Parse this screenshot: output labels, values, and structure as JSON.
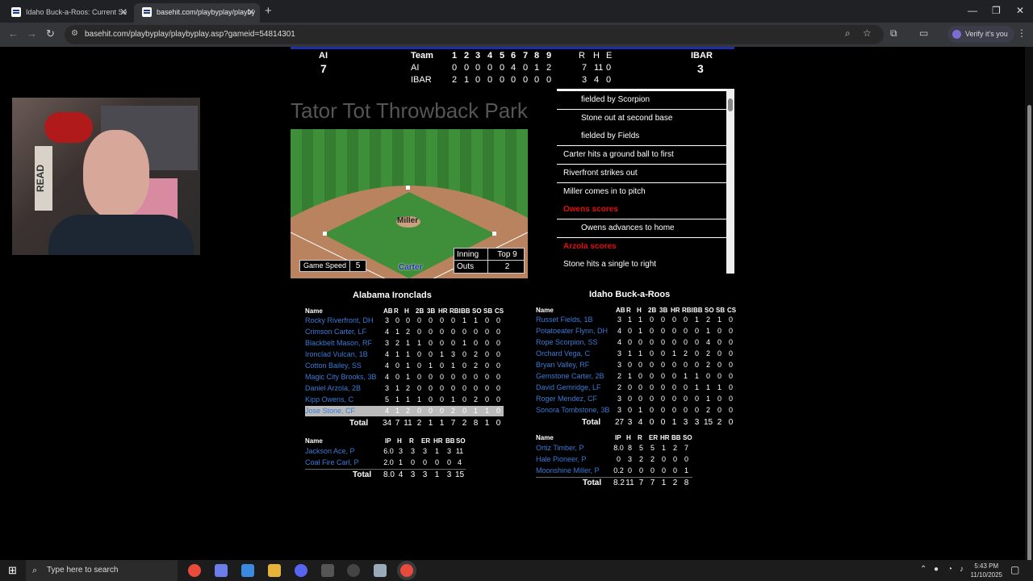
{
  "browser": {
    "tabs": [
      {
        "title": "Idaho Buck-a-Roos: Current Se",
        "active": false
      },
      {
        "title": "basehit.com/playbyplay/playby",
        "active": true
      }
    ],
    "url": "basehit.com/playbyplay/playbyplay.asp?gameid=54814301",
    "profile_label": "Verify it's you"
  },
  "scoreboard": {
    "away_abbr": "AI",
    "away_runs": "7",
    "home_abbr": "IBAR",
    "home_runs": "3",
    "header_team": "Team",
    "innings": [
      "1",
      "2",
      "3",
      "4",
      "5",
      "6",
      "7",
      "8",
      "9"
    ],
    "rhe_headers": [
      "R",
      "H",
      "E"
    ],
    "rows": [
      {
        "team": "AI",
        "line": [
          "0",
          "0",
          "0",
          "0",
          "0",
          "4",
          "0",
          "1",
          "2"
        ],
        "rhe": [
          "7",
          "11",
          "0"
        ]
      },
      {
        "team": "IBAR",
        "line": [
          "2",
          "1",
          "0",
          "0",
          "0",
          "0",
          "0",
          "0",
          "0"
        ],
        "rhe": [
          "3",
          "4",
          "0"
        ]
      }
    ]
  },
  "park_name": "Tator Tot Throwback Park",
  "field": {
    "pitcher": "Miller",
    "batter": "Carter",
    "game_speed_label": "Game Speed",
    "game_speed": "5",
    "inning_label": "Inning",
    "inning": "Top 9",
    "outs_label": "Outs",
    "outs": "2"
  },
  "play_by_play": [
    {
      "text": "fielded by Scorpion",
      "indent": true,
      "highlight": false
    },
    {
      "text": "Stone out at second base",
      "indent": true,
      "highlight": false
    },
    {
      "text": "fielded by Fields",
      "indent": true,
      "highlight": false
    },
    {
      "text": "Carter hits a ground ball to first",
      "indent": false,
      "highlight": false
    },
    {
      "text": "Riverfront strikes out",
      "indent": false,
      "highlight": false
    },
    {
      "text": "Miller comes in to pitch",
      "indent": false,
      "highlight": false
    },
    {
      "text": "Owens scores",
      "indent": false,
      "highlight": true
    },
    {
      "text": "Owens advances to home",
      "indent": true,
      "highlight": false
    },
    {
      "text": "Arzola scores",
      "indent": false,
      "highlight": true
    },
    {
      "text": "Stone hits a single to right",
      "indent": false,
      "highlight": false
    }
  ],
  "box_away": {
    "team": "Alabama Ironclads",
    "bat_headers": [
      "Name",
      "AB",
      "R",
      "H",
      "2B",
      "3B",
      "HR",
      "RBI",
      "BB",
      "SO",
      "SB",
      "CS"
    ],
    "batters": [
      {
        "name": "Rocky Riverfront, DH",
        "stats": [
          "3",
          "0",
          "0",
          "0",
          "0",
          "0",
          "0",
          "1",
          "1",
          "0",
          "0"
        ]
      },
      {
        "name": "Crimson Carter, LF",
        "stats": [
          "4",
          "1",
          "2",
          "0",
          "0",
          "0",
          "0",
          "0",
          "0",
          "0",
          "0"
        ]
      },
      {
        "name": "Blackbelt Mason, RF",
        "stats": [
          "3",
          "2",
          "1",
          "1",
          "0",
          "0",
          "0",
          "1",
          "0",
          "0",
          "0"
        ]
      },
      {
        "name": "Ironclad Vulcan, 1B",
        "stats": [
          "4",
          "1",
          "1",
          "0",
          "0",
          "1",
          "3",
          "0",
          "2",
          "0",
          "0"
        ]
      },
      {
        "name": "Cotton Bailey, SS",
        "stats": [
          "4",
          "0",
          "1",
          "0",
          "1",
          "0",
          "1",
          "0",
          "2",
          "0",
          "0"
        ]
      },
      {
        "name": "Magic City Brooks, 3B",
        "stats": [
          "4",
          "0",
          "1",
          "0",
          "0",
          "0",
          "0",
          "0",
          "0",
          "0",
          "0"
        ]
      },
      {
        "name": "Daniel Arzola, 2B",
        "stats": [
          "3",
          "1",
          "2",
          "0",
          "0",
          "0",
          "0",
          "0",
          "0",
          "0",
          "0"
        ]
      },
      {
        "name": "Kipp Owens, C",
        "stats": [
          "5",
          "1",
          "1",
          "1",
          "0",
          "0",
          "1",
          "0",
          "2",
          "0",
          "0"
        ]
      },
      {
        "name": "Jose Stone, CF",
        "stats": [
          "4",
          "1",
          "2",
          "0",
          "0",
          "0",
          "2",
          "0",
          "1",
          "1",
          "0"
        ]
      }
    ],
    "bat_total_label": "Total",
    "bat_totals": [
      "34",
      "7",
      "11",
      "2",
      "1",
      "1",
      "7",
      "2",
      "8",
      "1",
      "0"
    ],
    "pitch_headers": [
      "Name",
      "IP",
      "H",
      "R",
      "ER",
      "HR",
      "BB",
      "SO"
    ],
    "pitchers": [
      {
        "name": "Jackson Ace, P",
        "stats": [
          "6.0",
          "3",
          "3",
          "3",
          "1",
          "3",
          "11"
        ]
      },
      {
        "name": "Coal Fire Carl, P",
        "stats": [
          "2.0",
          "1",
          "0",
          "0",
          "0",
          "0",
          "4"
        ]
      }
    ],
    "pitch_total_label": "Total",
    "pitch_totals": [
      "8.0",
      "4",
      "3",
      "3",
      "1",
      "3",
      "15"
    ]
  },
  "box_home": {
    "team": "Idaho Buck-a-Roos",
    "bat_headers": [
      "Name",
      "AB",
      "R",
      "H",
      "2B",
      "3B",
      "HR",
      "RBI",
      "BB",
      "SO",
      "SB",
      "CS"
    ],
    "batters": [
      {
        "name": "Russet Fields, 1B",
        "stats": [
          "3",
          "1",
          "1",
          "0",
          "0",
          "0",
          "0",
          "1",
          "2",
          "1",
          "0"
        ]
      },
      {
        "name": "Potatoeater Flynn, DH",
        "stats": [
          "4",
          "0",
          "1",
          "0",
          "0",
          "0",
          "0",
          "0",
          "1",
          "0",
          "0"
        ]
      },
      {
        "name": "Rope Scorpion, SS",
        "stats": [
          "4",
          "0",
          "0",
          "0",
          "0",
          "0",
          "0",
          "0",
          "4",
          "0",
          "0"
        ]
      },
      {
        "name": "Orchard Vega, C",
        "stats": [
          "3",
          "1",
          "1",
          "0",
          "0",
          "1",
          "2",
          "0",
          "2",
          "0",
          "0"
        ]
      },
      {
        "name": "Bryan Valley, RF",
        "stats": [
          "3",
          "0",
          "0",
          "0",
          "0",
          "0",
          "0",
          "0",
          "2",
          "0",
          "0"
        ]
      },
      {
        "name": "Gemstone Carter, 2B",
        "stats": [
          "2",
          "1",
          "0",
          "0",
          "0",
          "0",
          "1",
          "1",
          "0",
          "0",
          "0"
        ]
      },
      {
        "name": "David Gemridge, LF",
        "stats": [
          "2",
          "0",
          "0",
          "0",
          "0",
          "0",
          "0",
          "1",
          "1",
          "1",
          "0"
        ]
      },
      {
        "name": "Roger Mendez, CF",
        "stats": [
          "3",
          "0",
          "0",
          "0",
          "0",
          "0",
          "0",
          "0",
          "1",
          "0",
          "0"
        ]
      },
      {
        "name": "Sonora Tombstone, 3B",
        "stats": [
          "3",
          "0",
          "1",
          "0",
          "0",
          "0",
          "0",
          "0",
          "2",
          "0",
          "0"
        ]
      }
    ],
    "bat_total_label": "Total",
    "bat_totals": [
      "27",
      "3",
      "4",
      "0",
      "0",
      "1",
      "3",
      "3",
      "15",
      "2",
      "0"
    ],
    "pitch_headers": [
      "Name",
      "IP",
      "H",
      "R",
      "ER",
      "HR",
      "BB",
      "SO"
    ],
    "pitchers": [
      {
        "name": "Ortiz Timber, P",
        "stats": [
          "8.0",
          "8",
          "5",
          "5",
          "1",
          "2",
          "7"
        ]
      },
      {
        "name": "Hale Pioneer, P",
        "stats": [
          "0",
          "3",
          "2",
          "2",
          "0",
          "0",
          "0"
        ]
      },
      {
        "name": "Moonshine Miller, P",
        "stats": [
          "0.2",
          "0",
          "0",
          "0",
          "0",
          "0",
          "1"
        ]
      }
    ],
    "pitch_total_label": "Total",
    "pitch_totals": [
      "8.2",
      "11",
      "7",
      "7",
      "1",
      "2",
      "8"
    ]
  },
  "taskbar": {
    "search_placeholder": "Type here to search",
    "time": "5:43 PM",
    "date": "11/10/2025"
  }
}
